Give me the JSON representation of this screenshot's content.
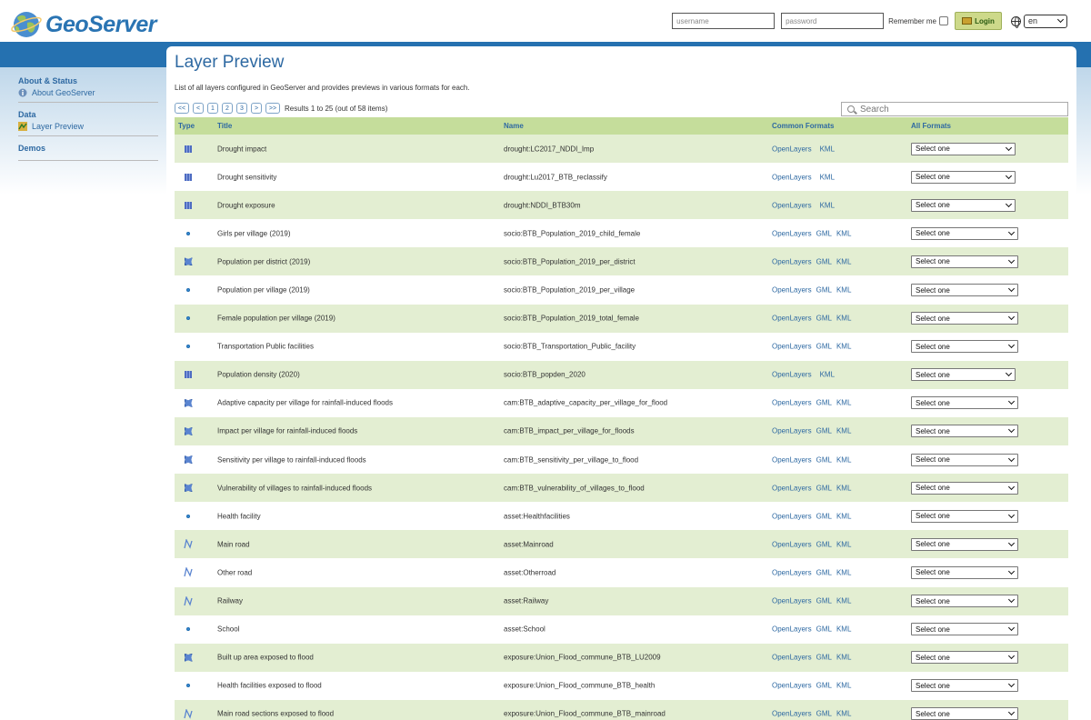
{
  "header": {
    "logo_text": "GeoServer",
    "username_placeholder": "username",
    "password_placeholder": "password",
    "remember_label": "Remember me",
    "login_label": "Login",
    "language": "en"
  },
  "sidebar": {
    "sections": [
      {
        "title": "About & Status",
        "items": [
          {
            "label": "About GeoServer",
            "icon": "info-icon"
          }
        ]
      },
      {
        "title": "Data",
        "items": [
          {
            "label": "Layer Preview",
            "icon": "layer-preview-icon"
          }
        ]
      },
      {
        "title": "Demos",
        "items": []
      }
    ]
  },
  "main": {
    "title": "Layer Preview",
    "description": "List of all layers configured in GeoServer and provides previews in various formats for each.",
    "pager": {
      "first": "<<",
      "prev": "<",
      "pages": [
        "1",
        "2",
        "3"
      ],
      "next": ">",
      "last": ">>",
      "results_text": "Results 1 to 25 (out of 58 items)"
    },
    "search_placeholder": "Search",
    "columns": {
      "type": "Type",
      "title": "Title",
      "name": "Name",
      "common": "Common Formats",
      "all": "All Formats"
    },
    "rows": [
      {
        "type": "raster",
        "title": "Drought impact",
        "name": "drought:LC2017_NDDI_Imp",
        "formats": [
          "OpenLayers",
          "KML"
        ],
        "select": "Select one"
      },
      {
        "type": "raster",
        "title": "Drought sensitivity",
        "name": "drought:Lu2017_BTB_reclassify",
        "formats": [
          "OpenLayers",
          "KML"
        ],
        "select": "Select one"
      },
      {
        "type": "raster",
        "title": "Drought exposure",
        "name": "drought:NDDI_BTB30m",
        "formats": [
          "OpenLayers",
          "KML"
        ],
        "select": "Select one"
      },
      {
        "type": "point",
        "title": "Girls per village (2019)",
        "name": "socio:BTB_Population_2019_child_female",
        "formats": [
          "OpenLayers",
          "GML",
          "KML"
        ],
        "select": "Select one"
      },
      {
        "type": "polygon",
        "title": "Population per district (2019)",
        "name": "socio:BTB_Population_2019_per_district",
        "formats": [
          "OpenLayers",
          "GML",
          "KML"
        ],
        "select": "Select one"
      },
      {
        "type": "point",
        "title": "Population per village (2019)",
        "name": "socio:BTB_Population_2019_per_village",
        "formats": [
          "OpenLayers",
          "GML",
          "KML"
        ],
        "select": "Select one"
      },
      {
        "type": "point",
        "title": "Female population per village (2019)",
        "name": "socio:BTB_Population_2019_total_female",
        "formats": [
          "OpenLayers",
          "GML",
          "KML"
        ],
        "select": "Select one"
      },
      {
        "type": "point",
        "title": "Transportation Public facilities",
        "name": "socio:BTB_Transportation_Public_facility",
        "formats": [
          "OpenLayers",
          "GML",
          "KML"
        ],
        "select": "Select one"
      },
      {
        "type": "raster",
        "title": "Population density (2020)",
        "name": "socio:BTB_popden_2020",
        "formats": [
          "OpenLayers",
          "KML"
        ],
        "select": "Select one"
      },
      {
        "type": "polygon",
        "title": "Adaptive capacity per village for rainfall-induced floods",
        "name": "cam:BTB_adaptive_capacity_per_village_for_flood",
        "formats": [
          "OpenLayers",
          "GML",
          "KML"
        ],
        "select": "Select one"
      },
      {
        "type": "polygon",
        "title": "Impact per village for rainfall-induced floods",
        "name": "cam:BTB_impact_per_village_for_floods",
        "formats": [
          "OpenLayers",
          "GML",
          "KML"
        ],
        "select": "Select one"
      },
      {
        "type": "polygon",
        "title": "Sensitivity per village to rainfall-induced floods",
        "name": "cam:BTB_sensitivity_per_village_to_flood",
        "formats": [
          "OpenLayers",
          "GML",
          "KML"
        ],
        "select": "Select one"
      },
      {
        "type": "polygon",
        "title": "Vulnerability of villages to rainfall-induced floods",
        "name": "cam:BTB_vulnerability_of_villages_to_flood",
        "formats": [
          "OpenLayers",
          "GML",
          "KML"
        ],
        "select": "Select one"
      },
      {
        "type": "point",
        "title": "Health facility",
        "name": "asset:Healthfacilities",
        "formats": [
          "OpenLayers",
          "GML",
          "KML"
        ],
        "select": "Select one"
      },
      {
        "type": "line",
        "title": "Main road",
        "name": "asset:Mainroad",
        "formats": [
          "OpenLayers",
          "GML",
          "KML"
        ],
        "select": "Select one"
      },
      {
        "type": "line",
        "title": "Other road",
        "name": "asset:Otherroad",
        "formats": [
          "OpenLayers",
          "GML",
          "KML"
        ],
        "select": "Select one"
      },
      {
        "type": "line",
        "title": "Railway",
        "name": "asset:Railway",
        "formats": [
          "OpenLayers",
          "GML",
          "KML"
        ],
        "select": "Select one"
      },
      {
        "type": "point",
        "title": "School",
        "name": "asset:School",
        "formats": [
          "OpenLayers",
          "GML",
          "KML"
        ],
        "select": "Select one"
      },
      {
        "type": "polygon",
        "title": "Built up area exposed to flood",
        "name": "exposure:Union_Flood_commune_BTB_LU2009",
        "formats": [
          "OpenLayers",
          "GML",
          "KML"
        ],
        "select": "Select one"
      },
      {
        "type": "point",
        "title": "Health facilities exposed to flood",
        "name": "exposure:Union_Flood_commune_BTB_health",
        "formats": [
          "OpenLayers",
          "GML",
          "KML"
        ],
        "select": "Select one"
      },
      {
        "type": "line",
        "title": "Main road sections exposed to flood",
        "name": "exposure:Union_Flood_commune_BTB_mainroad",
        "formats": [
          "OpenLayers",
          "GML",
          "KML"
        ],
        "select": "Select one"
      }
    ]
  },
  "colors": {
    "brand_blue": "#2571b0",
    "link": "#2e69a2",
    "row_alt": "#e3eed2",
    "header_green": "#c5dd9b"
  }
}
